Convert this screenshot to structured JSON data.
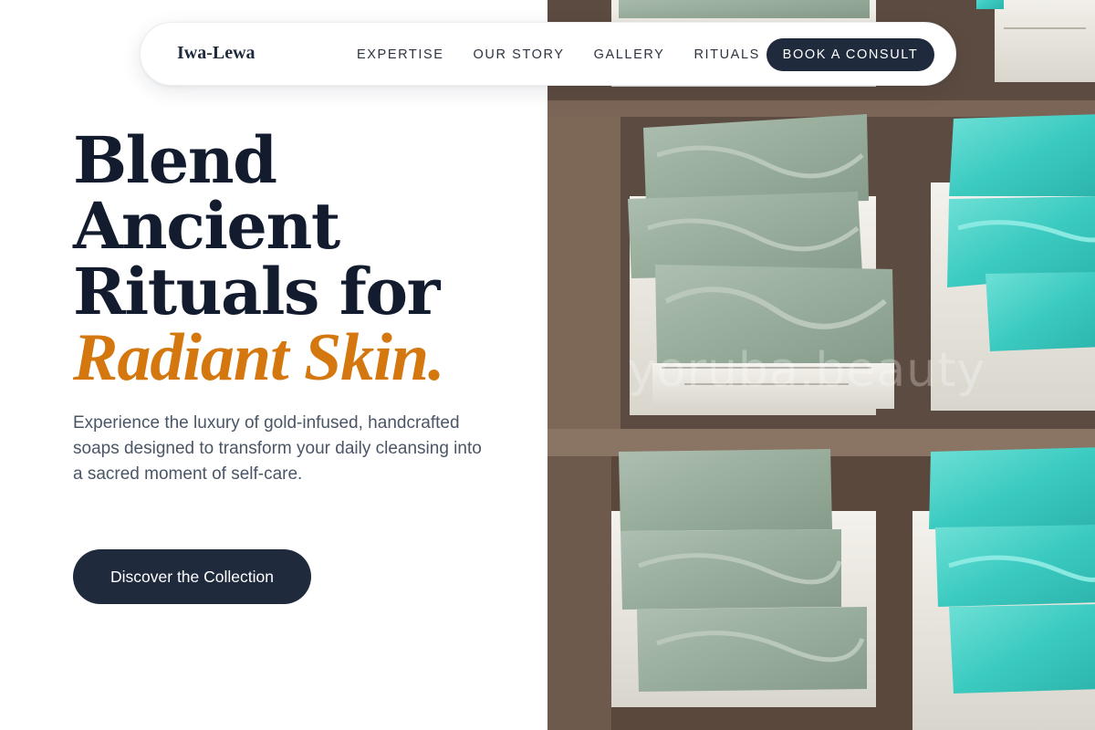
{
  "nav": {
    "brand": "Iwa-Lewa",
    "links": [
      "EXPERTISE",
      "OUR STORY",
      "GALLERY",
      "RITUALS"
    ],
    "cta_label": "BOOK A CONSULT"
  },
  "hero": {
    "title_lines": [
      "Blend",
      "Ancient",
      "Rituals for"
    ],
    "title_accent": "Radiant Skin.",
    "description": "Experience the luxury of gold-infused, handcrafted soaps designed to transform your daily cleansing into a sacred moment of self-care.",
    "cta_label": "Discover the Collection"
  },
  "image": {
    "watermark": "yoruba.beauty",
    "subject": "handmade-soap-bars-photo"
  },
  "colors": {
    "navy": "#1f2a3d",
    "accent_orange": "#d4770f",
    "sage_soap": "#9fb3a3",
    "turquoise_soap": "#3fc9c0",
    "wood": "#6a574a"
  }
}
